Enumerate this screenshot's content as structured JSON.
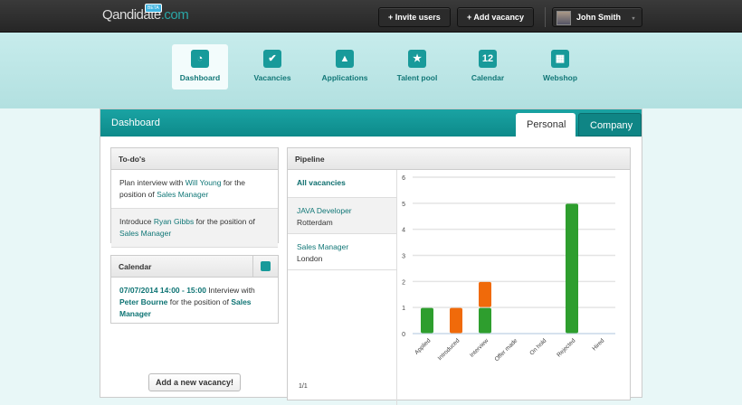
{
  "header": {
    "logo_main": "Qandidate",
    "logo_ext": ".com",
    "beta": "BETA",
    "invite": "+  Invite users",
    "add": "+  Add vacancy",
    "user": "John Smith",
    "caret": "▾"
  },
  "nav": [
    {
      "label": "Dashboard",
      "icon": "◔"
    },
    {
      "label": "Vacancies",
      "icon": "✔"
    },
    {
      "label": "Applications",
      "icon": "▲"
    },
    {
      "label": "Talent pool",
      "icon": "★"
    },
    {
      "label": "Calendar",
      "icon": "12"
    },
    {
      "label": "Webshop",
      "icon": "▦"
    }
  ],
  "panel": {
    "title": "Dashboard",
    "tabs": [
      "Personal",
      "Company"
    ]
  },
  "todos": {
    "title": "To-do's",
    "items": [
      {
        "a": "Plan interview with ",
        "b": "Will Young",
        "c": " for the position of ",
        "d": "Sales Manager"
      },
      {
        "a": "Introduce ",
        "b": "Ryan Gibbs",
        "c": " for the position of ",
        "d": "Sales Manager"
      }
    ]
  },
  "calendar": {
    "title": "Calendar",
    "date": "07/07/2014 14:00 - 15:00",
    "t1": " Interview with ",
    "person": "Peter Bourne",
    "t2": " for the position of ",
    "pos": "Sales Manager"
  },
  "add_vacancy": "Add a new vacancy!",
  "pipeline": {
    "title": "Pipeline",
    "all": "All vacancies",
    "vacancies": [
      {
        "title": "JAVA Developer",
        "city": "Rotterdam"
      },
      {
        "title": "Sales Manager",
        "city": "London"
      }
    ],
    "pager": "1/1"
  },
  "colors": {
    "green": "#2e9e2e",
    "orange": "#f06a0a",
    "teal": "#128f8f"
  },
  "chart_data": {
    "type": "bar",
    "stacked": true,
    "categories": [
      "Applied",
      "Introduced",
      "Interview",
      "Offer made",
      "On hold",
      "Rejected",
      "Hired"
    ],
    "series": [
      {
        "color": "#2e9e2e",
        "values": [
          1,
          0,
          1,
          0,
          0,
          5,
          0
        ]
      },
      {
        "color": "#f06a0a",
        "values": [
          0,
          1,
          1,
          0,
          0,
          0,
          0
        ]
      }
    ],
    "ylim": [
      0,
      6
    ],
    "yticks": [
      0,
      1,
      2,
      3,
      4,
      5,
      6
    ],
    "grid": true
  }
}
